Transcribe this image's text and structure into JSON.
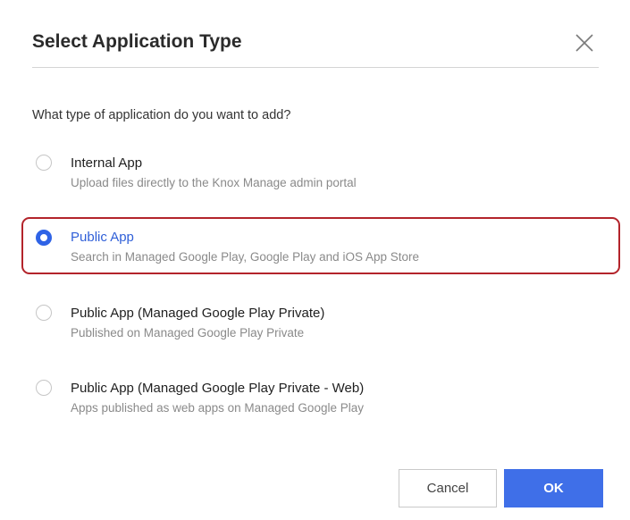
{
  "dialog": {
    "title": "Select Application Type",
    "question": "What type of application do you want to add?",
    "options": [
      {
        "title": "Internal App",
        "description": "Upload files directly to the Knox Manage admin portal",
        "selected": false
      },
      {
        "title": "Public App",
        "description": "Search in Managed Google Play, Google Play and iOS App Store",
        "selected": true
      },
      {
        "title": "Public App (Managed Google Play Private)",
        "description": "Published on Managed Google Play Private",
        "selected": false
      },
      {
        "title": "Public App (Managed Google Play Private - Web)",
        "description": "Apps published as web apps on Managed Google Play",
        "selected": false
      }
    ],
    "cancel_label": "Cancel",
    "ok_label": "OK"
  },
  "icons": {
    "close": "close-icon"
  },
  "colors": {
    "accent": "#3f6fe8",
    "selected_text": "#2f5fd8",
    "highlight_border": "#b3242b",
    "title_text": "#2b2b2b",
    "description_text": "#8a8a8a"
  }
}
